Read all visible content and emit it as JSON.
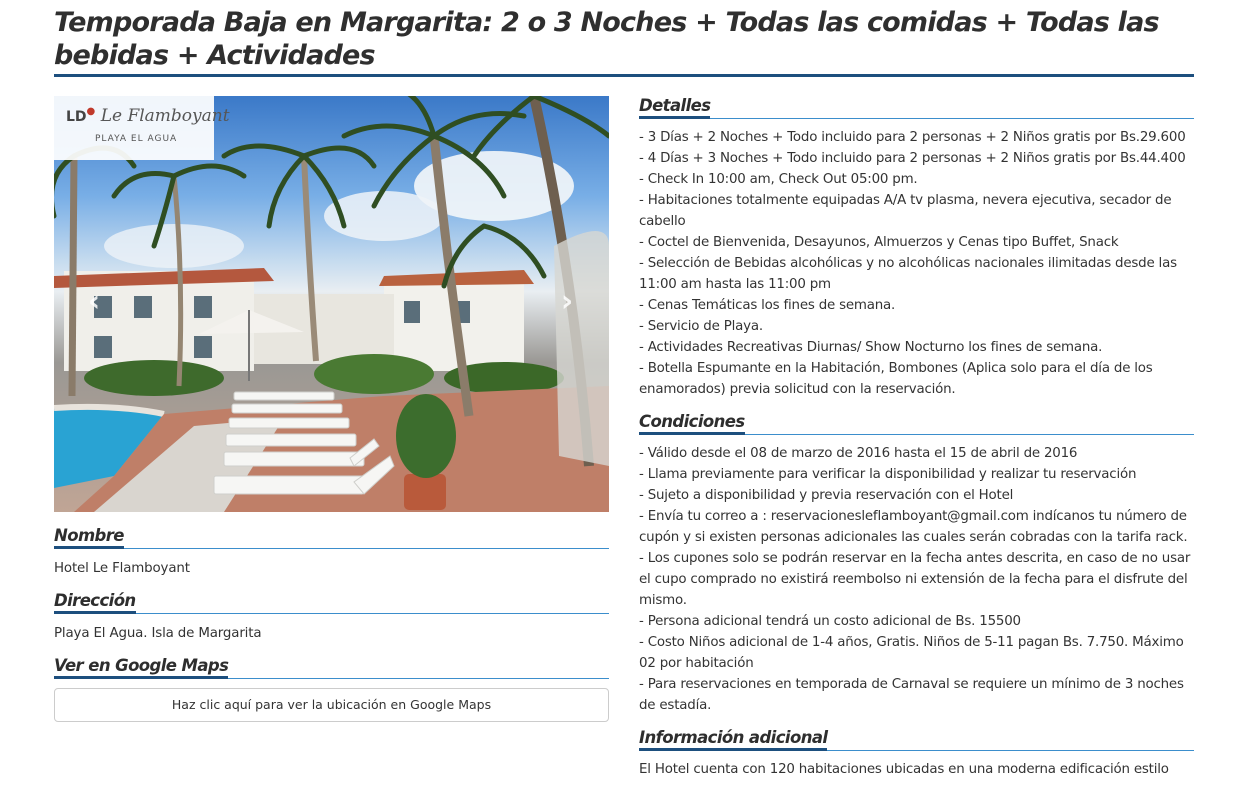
{
  "title": "Temporada Baja en Margarita: 2 o 3 Noches + Todas las comidas + Todas las bebidas + Actividades",
  "carousel": {
    "logo_text": "Le Flamboyant",
    "logo_prefix": "LD",
    "logo_subtitle": "PLAYA EL AGUA",
    "prev_arrow": "‹",
    "next_arrow": "›"
  },
  "nombre": {
    "heading": "Nombre",
    "value": "Hotel Le Flamboyant"
  },
  "direccion": {
    "heading": "Dirección",
    "value": "Playa El Agua. Isla de Margarita"
  },
  "maps": {
    "heading": "Ver en Google Maps",
    "button_label": "Haz clic aquí para ver la ubicación en Google Maps"
  },
  "detalles": {
    "heading": "Detalles",
    "items": [
      "- 3 Días + 2 Noches + Todo incluido para 2 personas + 2 Niños gratis por Bs.29.600",
      "- 4 Días + 3 Noches + Todo incluido para 2 personas + 2 Niños gratis por Bs.44.400",
      "- Check In 10:00 am, Check Out 05:00 pm.",
      "- Habitaciones totalmente equipadas A/A tv plasma, nevera ejecutiva, secador de cabello",
      "- Coctel de Bienvenida, Desayunos, Almuerzos y Cenas tipo Buffet, Snack",
      "- Selección de Bebidas alcohólicas y no alcohólicas nacionales ilimitadas desde las 11:00 am hasta las 11:00 pm",
      "- Cenas Temáticas los fines de semana.",
      "- Servicio de Playa.",
      "- Actividades Recreativas Diurnas/ Show Nocturno los fines de semana.",
      "- Botella Espumante en la Habitación, Bombones (Aplica solo para el día de los enamorados) previa solicitud con la reservación."
    ]
  },
  "condiciones": {
    "heading": "Condiciones",
    "items": [
      "- Válido desde el 08 de marzo de 2016 hasta el 15 de abril de 2016",
      "- Llama previamente para verificar la disponibilidad y realizar tu reservación",
      "- Sujeto a disponibilidad y previa reservación con el Hotel",
      "- Envía tu correo a : reservacionesleflamboyant@gmail.com indícanos tu número de cupón y si existen personas adicionales las cuales serán cobradas con la tarifa rack.",
      "- Los cupones solo se podrán reservar en la fecha antes descrita, en caso de no usar el cupo comprado no existirá reembolso ni extensión de la fecha para el disfrute del mismo.",
      "- Persona adicional tendrá un costo adicional de Bs. 15500",
      "- Costo Niños adicional de 1-4 años, Gratis. Niños de 5-11 pagan Bs. 7.750. Máximo 02 por habitación",
      "- Para reservaciones en temporada de Carnaval se requiere un mínimo de 3 noches de estadía."
    ]
  },
  "info_adicional": {
    "heading": "Información adicional",
    "text": "El Hotel cuenta con 120 habitaciones ubicadas en una moderna edificación estilo"
  }
}
